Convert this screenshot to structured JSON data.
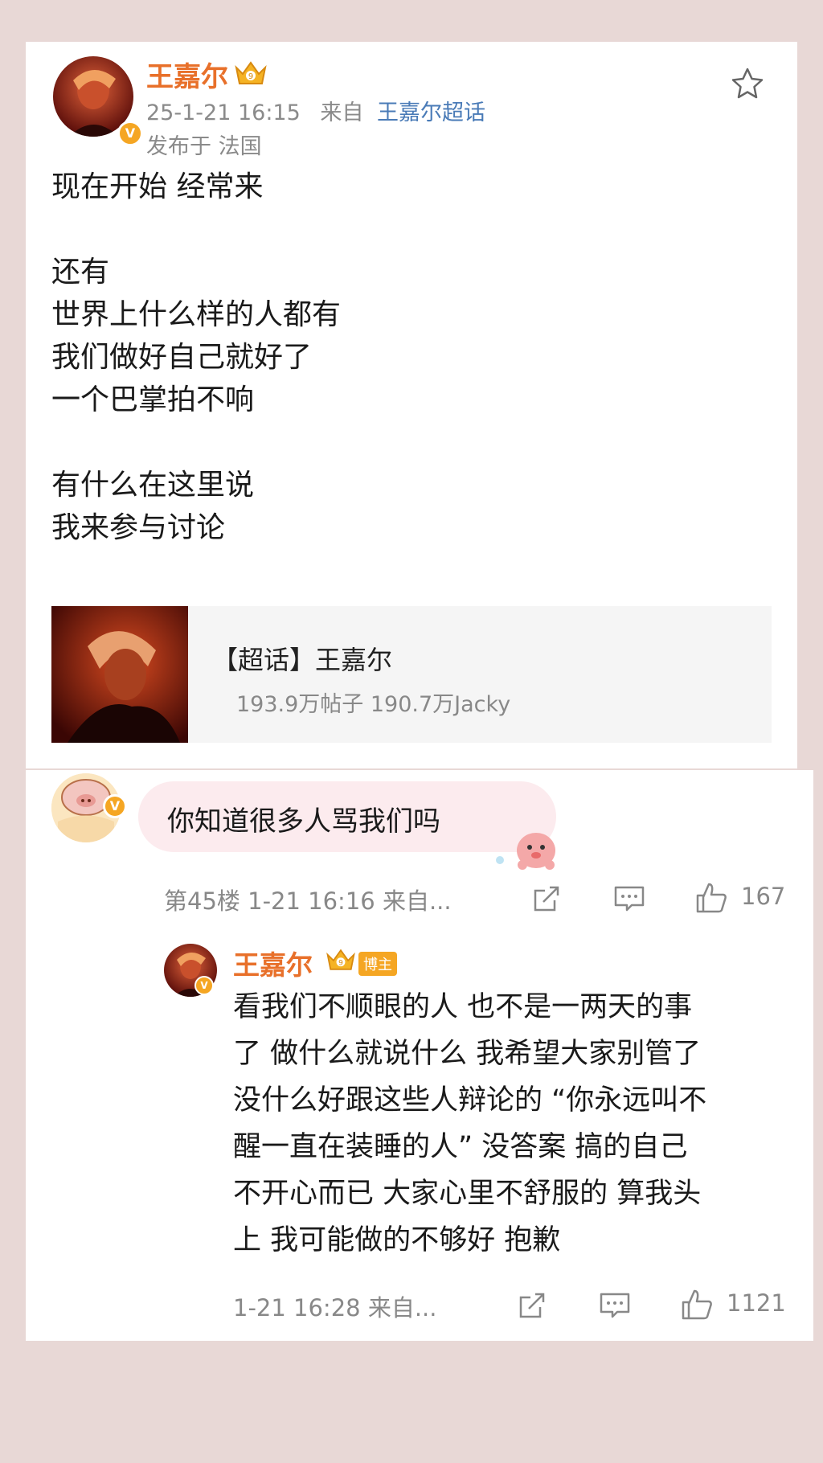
{
  "post": {
    "username": "王嘉尔",
    "timestamp": "25-1-21 16:15",
    "source_prefix": "来自",
    "source": "王嘉尔超话",
    "location": "发布于 法国",
    "lines": [
      "现在开始 经常来",
      "",
      "还有",
      "世界上什么样的人都有",
      "我们做好自己就好了",
      "一个巴掌拍不响",
      "",
      "有什么在这里说",
      "我来参与讨论"
    ],
    "topic": {
      "title": "【超话】王嘉尔",
      "stats": "193.9万帖子 190.7万Jacky"
    }
  },
  "comment": {
    "text": "你知道很多人骂我们吗",
    "meta": "第45楼 1-21 16:16 来自...",
    "likes": "167"
  },
  "reply": {
    "username": "王嘉尔",
    "badge": "博主",
    "lines": [
      "看我们不顺眼的人 也不是一两天的事",
      "了 做什么就说什么 我希望大家别管了",
      "没什么好跟这些人辩论的 “你永远叫不",
      "醒一直在装睡的人” 没答案 搞的自己",
      "不开心而已 大家心里不舒服的 算我头",
      "上 我可能做的不够好 抱歉"
    ],
    "meta": "1-21 16:28 来自...",
    "likes": "1121"
  },
  "icons": {
    "favorite": "star-icon",
    "share": "share-icon",
    "comment": "comment-icon",
    "like": "thumbs-up-icon",
    "verified": "verified-badge-icon",
    "crown": "crown-icon"
  },
  "colors": {
    "username": "#e8702a",
    "source_link": "#4a7bb7",
    "verified": "#f5a623",
    "bubble": "#fcebee",
    "background": "#e8d8d6"
  }
}
